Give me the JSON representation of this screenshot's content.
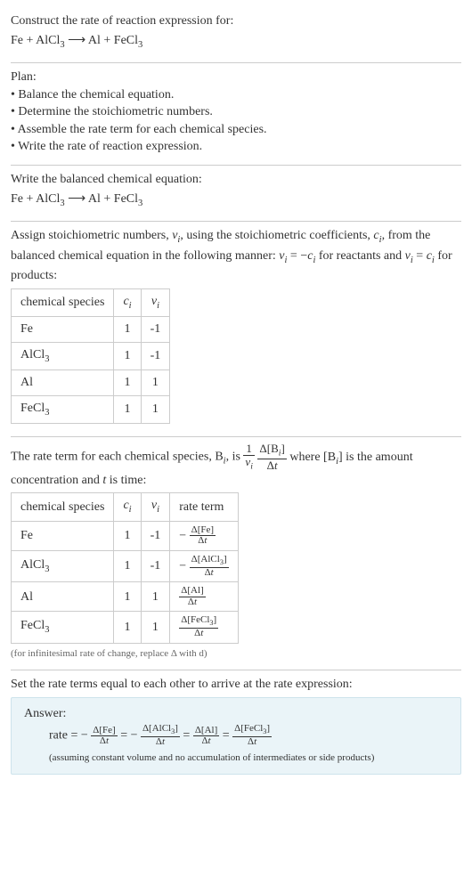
{
  "prompt": {
    "title": "Construct the rate of reaction expression for:",
    "equation_html": "Fe + AlCl<sub>3</sub> ⟶ Al + FeCl<sub>3</sub>"
  },
  "plan": {
    "heading": "Plan:",
    "b1": "Balance the chemical equation.",
    "b2": "Determine the stoichiometric numbers.",
    "b3": "Assemble the rate term for each chemical species.",
    "b4": "Write the rate of reaction expression."
  },
  "balanced": {
    "heading": "Write the balanced chemical equation:",
    "equation_html": "Fe + AlCl<sub>3</sub> ⟶ Al + FeCl<sub>3</sub>"
  },
  "stoich": {
    "intro_html": "Assign stoichiometric numbers, <span class=\"ital\">ν<sub>i</sub></span>, using the stoichiometric coefficients, <span class=\"ital\">c<sub>i</sub></span>, from the balanced chemical equation in the following manner: <span class=\"ital\">ν<sub>i</sub></span> = −<span class=\"ital\">c<sub>i</sub></span> for reactants and <span class=\"ital\">ν<sub>i</sub></span> = <span class=\"ital\">c<sub>i</sub></span> for products:",
    "h_species": "chemical species",
    "h_ci_html": "<span class=\"ital\">c<sub>i</sub></span>",
    "h_vi_html": "<span class=\"ital\">ν<sub>i</sub></span>",
    "r1_sp": "Fe",
    "r1_c": "1",
    "r1_v": "-1",
    "r2_sp_html": "AlCl<sub>3</sub>",
    "r2_c": "1",
    "r2_v": "-1",
    "r3_sp": "Al",
    "r3_c": "1",
    "r3_v": "1",
    "r4_sp_html": "FeCl<sub>3</sub>",
    "r4_c": "1",
    "r4_v": "1"
  },
  "rateterm": {
    "intro_pre": "The rate term for each chemical species, B",
    "intro_post": ", is ",
    "intro_tail_html": " where [B<sub><span class=\"ital\">i</span></sub>] is the amount concentration and <span class=\"ital\">t</span> is time:",
    "h_species": "chemical species",
    "h_ci_html": "<span class=\"ital\">c<sub>i</sub></span>",
    "h_vi_html": "<span class=\"ital\">ν<sub>i</sub></span>",
    "h_term": "rate term",
    "r1_sp": "Fe",
    "r1_c": "1",
    "r1_v": "-1",
    "r2_sp_html": "AlCl<sub>3</sub>",
    "r2_c": "1",
    "r2_v": "-1",
    "r3_sp": "Al",
    "r3_c": "1",
    "r3_v": "1",
    "r4_sp_html": "FeCl<sub>3</sub>",
    "r4_c": "1",
    "r4_v": "1",
    "note": "(for infinitesimal rate of change, replace Δ with d)"
  },
  "final": {
    "heading": "Set the rate terms equal to each other to arrive at the rate expression:",
    "answer_label": "Answer:",
    "rate_prefix": "rate = ",
    "assumption": "(assuming constant volume and no accumulation of intermediates or side products)"
  }
}
